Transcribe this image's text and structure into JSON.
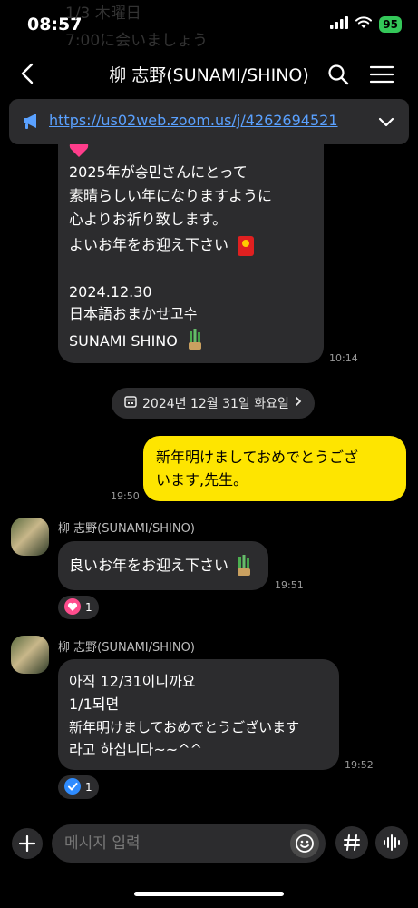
{
  "status": {
    "time": "08:57",
    "battery": "95"
  },
  "behind_text": [
    "1/3 木曜日",
    "7:00に会いましょう"
  ],
  "header": {
    "title": "柳 志野(SUNAMI/SHINO)"
  },
  "notice": {
    "link": "https://us02web.zoom.us/j/4262694521"
  },
  "messages": {
    "m1": {
      "lines": [
        "2025年が승민さんにとって",
        "素晴らしい年になりますように",
        "心よりお祈り致します。",
        "よいお年をお迎え下さい",
        "2024.12.30",
        "日本語おまかせ고수",
        "SUNAMI SHINO"
      ],
      "time": "10:14"
    },
    "date_divider": "2024년 12월 31일 화요일",
    "m2": {
      "lines": [
        "新年明けましておめでとうござ",
        "います,先生。"
      ],
      "time": "19:50"
    },
    "m3": {
      "sender": "柳 志野(SUNAMI/SHINO)",
      "text": "良いお年をお迎え下さい",
      "time": "19:51",
      "reaction_count": "1"
    },
    "m4": {
      "sender": "柳 志野(SUNAMI/SHINO)",
      "lines": [
        "아직 12/31이니까요",
        "1/1되면",
        "新年明けましておめでとうございます",
        "라고 하십니다~~^^"
      ],
      "time": "19:52",
      "reaction_count": "1"
    }
  },
  "composer": {
    "placeholder": "메시지 입력"
  },
  "colors": {
    "my_bubble": "#fee500",
    "their_bubble": "#2c2c2e",
    "link": "#5aa1ff"
  }
}
